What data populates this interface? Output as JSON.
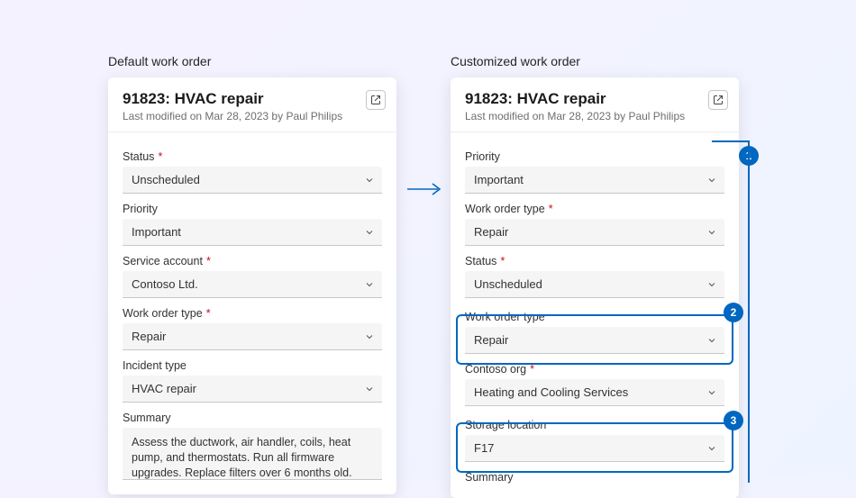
{
  "left": {
    "title": "Default work order",
    "card_title": "91823: HVAC repair",
    "card_sub": "Last modified on Mar 28, 2023 by Paul Philips",
    "fields": {
      "status_label": "Status",
      "status_value": "Unscheduled",
      "priority_label": "Priority",
      "priority_value": "Important",
      "service_account_label": "Service account",
      "service_account_value": "Contoso Ltd.",
      "wot_label": "Work order type",
      "wot_value": "Repair",
      "incident_label": "Incident type",
      "incident_value": "HVAC repair",
      "summary_label": "Summary",
      "summary_value": "Assess the ductwork, air handler, coils, heat pump, and thermostats. Run all firmware upgrades. Replace filters over 6 months old."
    }
  },
  "right": {
    "title": "Customized work order",
    "card_title": "91823: HVAC repair",
    "card_sub": "Last modified on Mar 28, 2023 by Paul Philips",
    "fields": {
      "priority_label": "Priority",
      "priority_value": "Important",
      "wot1_label": "Work order type",
      "wot1_value": "Repair",
      "status_label": "Status",
      "status_value": "Unscheduled",
      "wot2_label": "Work order type",
      "wot2_value": "Repair",
      "contoso_label": "Contoso org",
      "contoso_value": "Heating and Cooling Services",
      "storage_label": "Storage location",
      "storage_value": "F17",
      "summary_label": "Summary"
    }
  },
  "badges": {
    "b1": "1",
    "b2": "2",
    "b3": "3"
  }
}
